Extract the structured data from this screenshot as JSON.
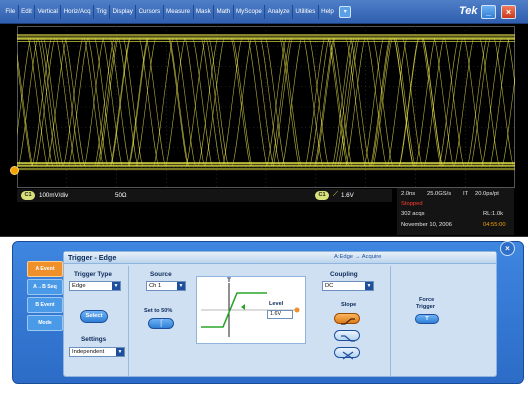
{
  "menu": {
    "items": [
      "File",
      "Edit",
      "Vertical",
      "Horiz/Acq",
      "Trig",
      "Display",
      "Cursors",
      "Measure",
      "Mask",
      "Math",
      "MyScope",
      "Analyze",
      "Utilities",
      "Help"
    ],
    "dropdown_icon": "chevron-down-icon",
    "brand": "Tek",
    "min_icon": "minimize-icon",
    "close_icon": "close-icon"
  },
  "scope": {
    "trace_color": "#e9e64a",
    "ch1_badge": "C1",
    "ch1_scale": "100mV/div",
    "ch1_impedance": "50Ω",
    "trigger_badge": "C1",
    "trigger_level": "1.6V",
    "trigger_slope_icon": "rising-edge-icon",
    "acq": {
      "timebase": "2.0ns",
      "sample_rate": "25.0GS/s",
      "it": "IT",
      "pt_rate": "20.0ps/pt",
      "status": "Stopped",
      "acqs": "302 acqs",
      "record_length": "RL:1.0k",
      "date": "November 10, 2006",
      "time": "04:55:00"
    }
  },
  "trigger_panel": {
    "close_icon": "close-icon",
    "side_tabs": [
      "A Event",
      "A→B Seq",
      "B Event",
      "Mode"
    ],
    "active_tab_index": 0,
    "title": "Trigger - Edge",
    "status": "A:Edge → Acquire",
    "trigger_type_label": "Trigger Type",
    "trigger_type_value": "Edge",
    "select_label": "Select",
    "settings_label": "Settings",
    "settings_value": "Independent",
    "source_label": "Source",
    "source_value": "Ch 1",
    "set50_label": "Set to 50%",
    "diagram_t_label": "T",
    "level_label": "Level",
    "level_value": "1.6V",
    "coupling_label": "Coupling",
    "coupling_value": "DC",
    "slope_label": "Slope",
    "slope_options": [
      "rising-slope-icon",
      "falling-slope-icon",
      "either-slope-icon"
    ],
    "selected_slope_index": 0,
    "force_trigger_label_1": "Force",
    "force_trigger_label_2": "Trigger",
    "force_trigger_button_icon": "t-icon"
  }
}
